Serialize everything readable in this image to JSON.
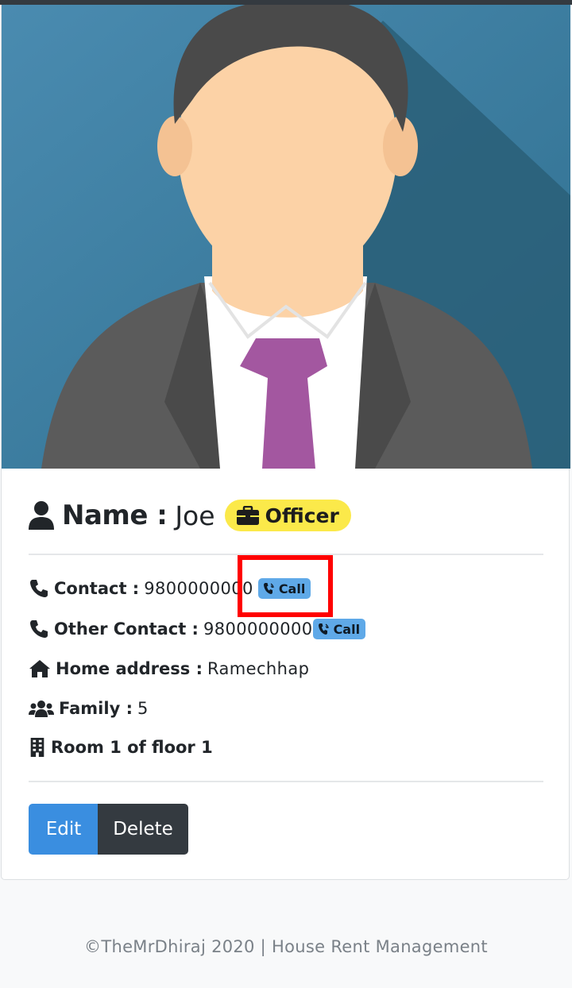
{
  "profile": {
    "name_label": "Name :",
    "name": "Joe",
    "role": "Officer",
    "contact_label": "Contact :",
    "contact": "9800000000",
    "other_contact_label": "Other Contact :",
    "other_contact": "9800000000",
    "home_address_label": "Home address :",
    "home_address": "Ramechhap",
    "family_label": "Family :",
    "family": "5",
    "room": "Room 1 of floor 1"
  },
  "actions": {
    "call_label": "Call",
    "edit_label": "Edit",
    "delete_label": "Delete"
  },
  "footer": {
    "text": "©TheMrDhiraj 2020 | House Rent Management"
  },
  "icons": {
    "avatar": "person-avatar-illustration",
    "name": "user-icon",
    "role": "briefcase-icon",
    "contact": "phone-icon",
    "call": "phone-volume-icon",
    "address": "home-icon",
    "family": "users-icon",
    "room": "building-icon"
  },
  "colors": {
    "role_badge": "#fbe94a",
    "call_badge": "#5fa9e8",
    "edit_button": "#3a8ee0",
    "delete_button": "#343a40",
    "highlight": "#ff0000"
  }
}
